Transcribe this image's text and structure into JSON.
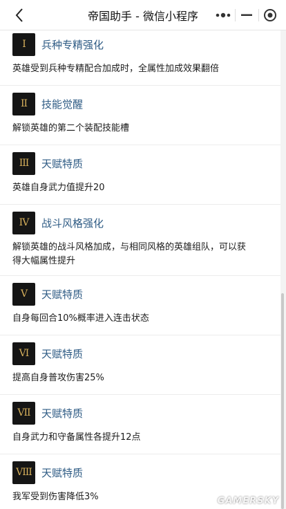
{
  "navbar": {
    "title": "帝国助手 - 微信小程序",
    "back_icon": "chevron-left-icon",
    "more_icon": "more-dots-icon",
    "minimize_icon": "minus-icon",
    "close_icon": "target-circle-icon"
  },
  "items": [
    {
      "numeral": "I",
      "title": "兵种专精强化",
      "desc": "英雄受到兵种专精配合加成时，全属性加成效果翻倍"
    },
    {
      "numeral": "II",
      "title": "技能觉醒",
      "desc": "解锁英雄的第二个装配技能槽"
    },
    {
      "numeral": "III",
      "title": "天赋特质",
      "desc": "英雄自身武力值提升20"
    },
    {
      "numeral": "IV",
      "title": "战斗风格强化",
      "desc": "解锁英雄的战斗风格加成，与相同风格的英雄组队，可以获得大幅属性提升"
    },
    {
      "numeral": "V",
      "title": "天赋特质",
      "desc": "自身每回合10%概率进入连击状态"
    },
    {
      "numeral": "VI",
      "title": "天赋特质",
      "desc": "提高自身普攻伤害25%"
    },
    {
      "numeral": "VII",
      "title": "天赋特质",
      "desc": "自身武力和守备属性各提升12点"
    },
    {
      "numeral": "VIII",
      "title": "天赋特质",
      "desc": "我军受到伤害降低3%"
    }
  ],
  "watermark": "GAMERSKY",
  "colors": {
    "title_link": "#2e5b84",
    "badge_bg": "#151515",
    "badge_text": "#d8b15c"
  }
}
